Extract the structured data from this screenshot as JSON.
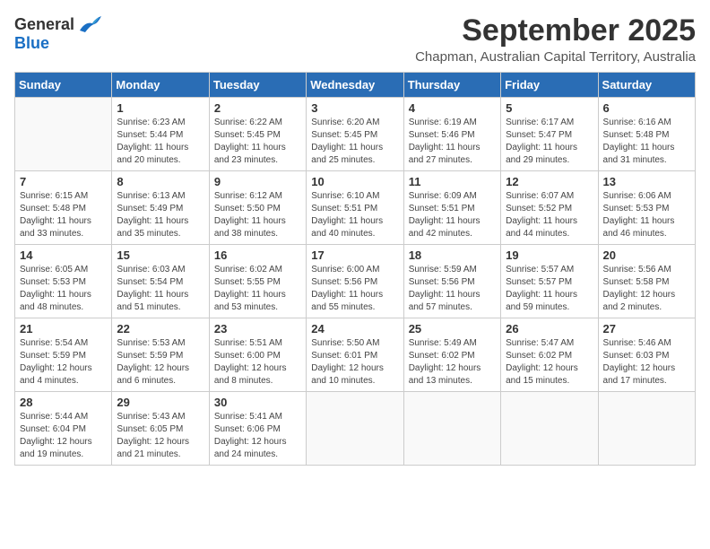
{
  "header": {
    "logo_general": "General",
    "logo_blue": "Blue",
    "month": "September 2025",
    "location": "Chapman, Australian Capital Territory, Australia"
  },
  "days_of_week": [
    "Sunday",
    "Monday",
    "Tuesday",
    "Wednesday",
    "Thursday",
    "Friday",
    "Saturday"
  ],
  "weeks": [
    [
      {
        "day": "",
        "info": ""
      },
      {
        "day": "1",
        "info": "Sunrise: 6:23 AM\nSunset: 5:44 PM\nDaylight: 11 hours\nand 20 minutes."
      },
      {
        "day": "2",
        "info": "Sunrise: 6:22 AM\nSunset: 5:45 PM\nDaylight: 11 hours\nand 23 minutes."
      },
      {
        "day": "3",
        "info": "Sunrise: 6:20 AM\nSunset: 5:45 PM\nDaylight: 11 hours\nand 25 minutes."
      },
      {
        "day": "4",
        "info": "Sunrise: 6:19 AM\nSunset: 5:46 PM\nDaylight: 11 hours\nand 27 minutes."
      },
      {
        "day": "5",
        "info": "Sunrise: 6:17 AM\nSunset: 5:47 PM\nDaylight: 11 hours\nand 29 minutes."
      },
      {
        "day": "6",
        "info": "Sunrise: 6:16 AM\nSunset: 5:48 PM\nDaylight: 11 hours\nand 31 minutes."
      }
    ],
    [
      {
        "day": "7",
        "info": "Sunrise: 6:15 AM\nSunset: 5:48 PM\nDaylight: 11 hours\nand 33 minutes."
      },
      {
        "day": "8",
        "info": "Sunrise: 6:13 AM\nSunset: 5:49 PM\nDaylight: 11 hours\nand 35 minutes."
      },
      {
        "day": "9",
        "info": "Sunrise: 6:12 AM\nSunset: 5:50 PM\nDaylight: 11 hours\nand 38 minutes."
      },
      {
        "day": "10",
        "info": "Sunrise: 6:10 AM\nSunset: 5:51 PM\nDaylight: 11 hours\nand 40 minutes."
      },
      {
        "day": "11",
        "info": "Sunrise: 6:09 AM\nSunset: 5:51 PM\nDaylight: 11 hours\nand 42 minutes."
      },
      {
        "day": "12",
        "info": "Sunrise: 6:07 AM\nSunset: 5:52 PM\nDaylight: 11 hours\nand 44 minutes."
      },
      {
        "day": "13",
        "info": "Sunrise: 6:06 AM\nSunset: 5:53 PM\nDaylight: 11 hours\nand 46 minutes."
      }
    ],
    [
      {
        "day": "14",
        "info": "Sunrise: 6:05 AM\nSunset: 5:53 PM\nDaylight: 11 hours\nand 48 minutes."
      },
      {
        "day": "15",
        "info": "Sunrise: 6:03 AM\nSunset: 5:54 PM\nDaylight: 11 hours\nand 51 minutes."
      },
      {
        "day": "16",
        "info": "Sunrise: 6:02 AM\nSunset: 5:55 PM\nDaylight: 11 hours\nand 53 minutes."
      },
      {
        "day": "17",
        "info": "Sunrise: 6:00 AM\nSunset: 5:56 PM\nDaylight: 11 hours\nand 55 minutes."
      },
      {
        "day": "18",
        "info": "Sunrise: 5:59 AM\nSunset: 5:56 PM\nDaylight: 11 hours\nand 57 minutes."
      },
      {
        "day": "19",
        "info": "Sunrise: 5:57 AM\nSunset: 5:57 PM\nDaylight: 11 hours\nand 59 minutes."
      },
      {
        "day": "20",
        "info": "Sunrise: 5:56 AM\nSunset: 5:58 PM\nDaylight: 12 hours\nand 2 minutes."
      }
    ],
    [
      {
        "day": "21",
        "info": "Sunrise: 5:54 AM\nSunset: 5:59 PM\nDaylight: 12 hours\nand 4 minutes."
      },
      {
        "day": "22",
        "info": "Sunrise: 5:53 AM\nSunset: 5:59 PM\nDaylight: 12 hours\nand 6 minutes."
      },
      {
        "day": "23",
        "info": "Sunrise: 5:51 AM\nSunset: 6:00 PM\nDaylight: 12 hours\nand 8 minutes."
      },
      {
        "day": "24",
        "info": "Sunrise: 5:50 AM\nSunset: 6:01 PM\nDaylight: 12 hours\nand 10 minutes."
      },
      {
        "day": "25",
        "info": "Sunrise: 5:49 AM\nSunset: 6:02 PM\nDaylight: 12 hours\nand 13 minutes."
      },
      {
        "day": "26",
        "info": "Sunrise: 5:47 AM\nSunset: 6:02 PM\nDaylight: 12 hours\nand 15 minutes."
      },
      {
        "day": "27",
        "info": "Sunrise: 5:46 AM\nSunset: 6:03 PM\nDaylight: 12 hours\nand 17 minutes."
      }
    ],
    [
      {
        "day": "28",
        "info": "Sunrise: 5:44 AM\nSunset: 6:04 PM\nDaylight: 12 hours\nand 19 minutes."
      },
      {
        "day": "29",
        "info": "Sunrise: 5:43 AM\nSunset: 6:05 PM\nDaylight: 12 hours\nand 21 minutes."
      },
      {
        "day": "30",
        "info": "Sunrise: 5:41 AM\nSunset: 6:06 PM\nDaylight: 12 hours\nand 24 minutes."
      },
      {
        "day": "",
        "info": ""
      },
      {
        "day": "",
        "info": ""
      },
      {
        "day": "",
        "info": ""
      },
      {
        "day": "",
        "info": ""
      }
    ]
  ]
}
